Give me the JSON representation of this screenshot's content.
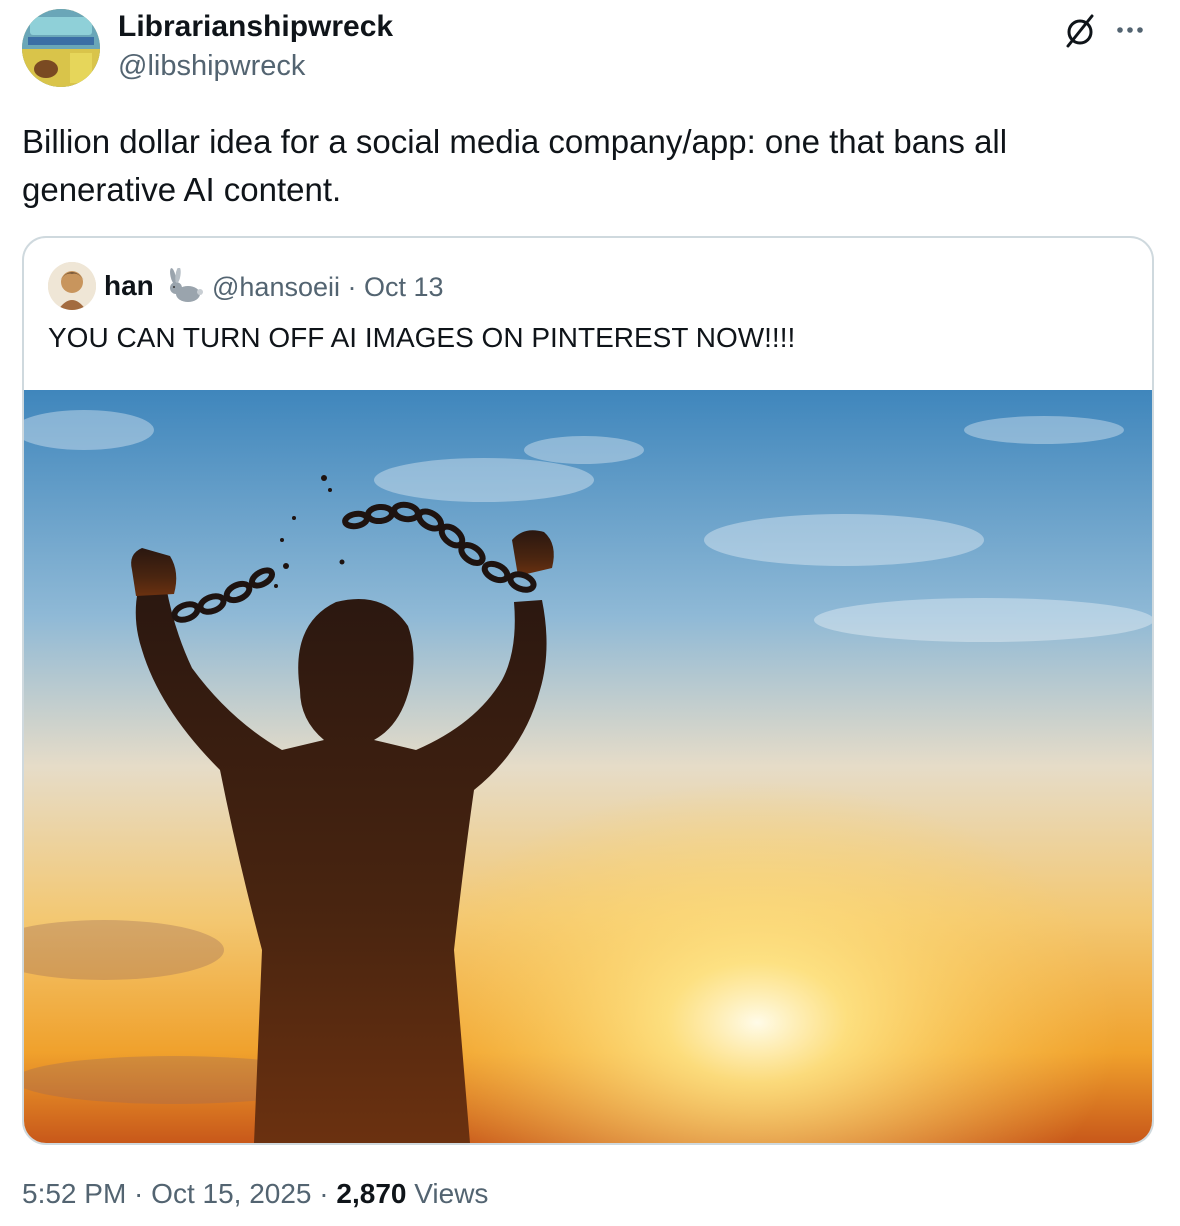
{
  "tweet": {
    "author": {
      "name": "Librarianshipwreck",
      "handle": "@libshipwreck"
    },
    "text": "Billion dollar idea for a social media company/app: one that bans all generative AI content.",
    "timestamp": "5:52 PM · Oct 15, 2025",
    "separator": " · ",
    "views_count": "2,870",
    "views_label": " Views"
  },
  "quoted": {
    "name": "han",
    "handle": "@hansoeii",
    "separator": " · ",
    "date": "Oct 13",
    "text": "YOU CAN TURN OFF AI IMAGES ON PINTEREST NOW!!!!"
  },
  "icons": {
    "grok": "grok-icon",
    "more": "more-options-icon",
    "rabbit": "rabbit-emoji-icon"
  },
  "colors": {
    "secondary_text": "#536471",
    "primary_text": "#0f1419",
    "border": "#cfd9de"
  }
}
